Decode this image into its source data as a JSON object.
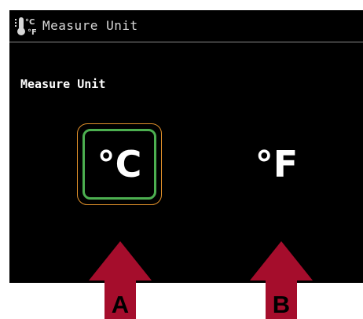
{
  "header": {
    "title": "Measure Unit",
    "icon": "thermometer-celsius-fahrenheit-icon"
  },
  "section": {
    "label": "Measure Unit"
  },
  "options": [
    {
      "label": "°C",
      "selected": true
    },
    {
      "label": "°F",
      "selected": false
    }
  ],
  "callouts": [
    {
      "label": "A"
    },
    {
      "label": "B"
    }
  ],
  "colors": {
    "screen_bg": "#000000",
    "selected_border": "#4caf50",
    "focus_ring": "#e0902a",
    "arrow": "#a50d2c"
  }
}
